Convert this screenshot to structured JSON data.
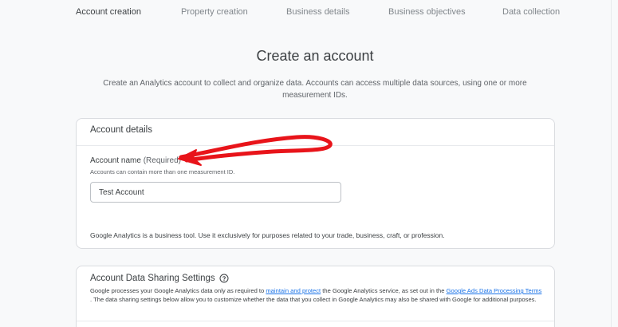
{
  "stepper": {
    "steps": [
      {
        "label": "Account creation",
        "active": true
      },
      {
        "label": "Property creation",
        "active": false
      },
      {
        "label": "Business details",
        "active": false
      },
      {
        "label": "Business objectives",
        "active": false
      },
      {
        "label": "Data collection",
        "active": false
      }
    ]
  },
  "header": {
    "title": "Create an account",
    "subtitle": "Create an Analytics account to collect and organize data. Accounts can access multiple data sources, using one or more measurement IDs."
  },
  "account_details": {
    "title": "Account details",
    "field_label": "Account name",
    "field_required": "(Required)",
    "field_hint": "Accounts can contain more than one measurement ID.",
    "field_value": "Test Account",
    "business_note": "Google Analytics is a business tool. Use it exclusively for purposes related to your trade, business, craft, or profession."
  },
  "data_sharing": {
    "title": "Account Data Sharing Settings",
    "help_icon": "help-circle-icon",
    "desc_part1": "Google processes your Google Analytics data only as required to ",
    "link1": "maintain and protect",
    "desc_part2": " the Google Analytics service, as set out in the ",
    "link2": "Google Ads Data Processing Terms",
    "desc_part3": " . The data sharing settings below allow you to customize whether the data that you collect in Google Analytics may also be shared with Google for additional purposes."
  },
  "annotation": {
    "icon": "red-arrow-annotation",
    "color": "#e8141a"
  }
}
